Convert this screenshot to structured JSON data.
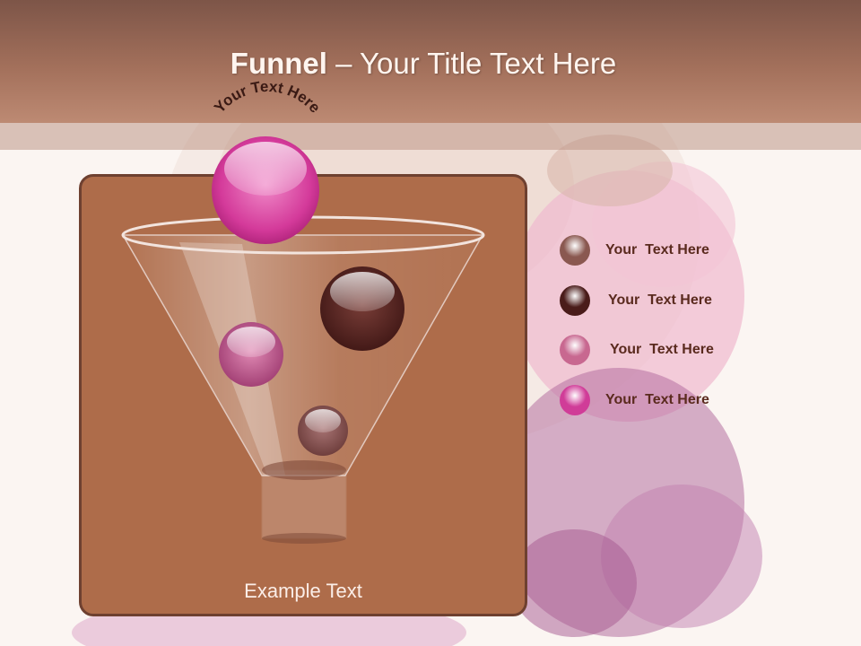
{
  "slide": {
    "title_bold": "Funnel",
    "title_rest": " – Your Title Text Here",
    "arc_text": "Your Text Here",
    "example_text": "Example Text"
  },
  "legend": [
    {
      "label": "Your  Text Here",
      "color": "#8a5850"
    },
    {
      "label": "Your  Text Here",
      "color": "#4a1c1a"
    },
    {
      "label": "Your  Text Here",
      "color": "#c86890"
    },
    {
      "label": "Your  Text Here",
      "color": "#d03c98"
    }
  ],
  "colors": {
    "header": "#a3705b",
    "panel": "#ae6c4a",
    "panel_border": "#6e4030",
    "top_ball": "#d63c9c",
    "legend_text": "#5a2a1e"
  }
}
